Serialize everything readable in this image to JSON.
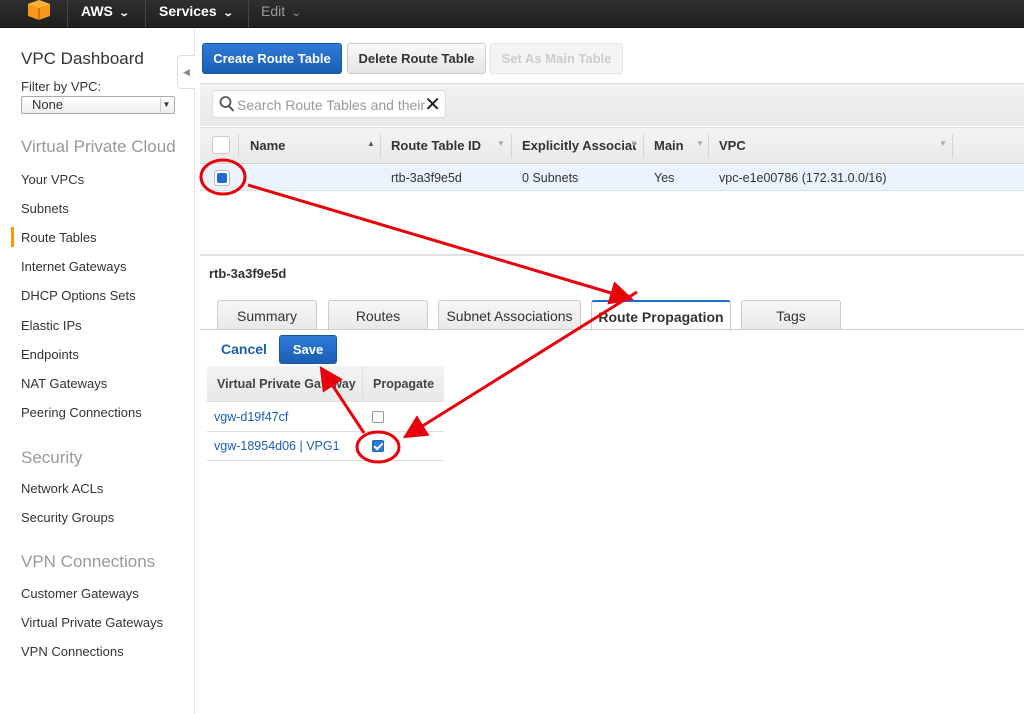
{
  "topbar": {
    "logo_icon": "aws-cube-icon",
    "menus": [
      {
        "label": "AWS",
        "dim": false
      },
      {
        "label": "Services",
        "dim": false
      },
      {
        "label": "Edit",
        "dim": true
      }
    ]
  },
  "sidebar": {
    "title": "VPC Dashboard",
    "filter_label": "Filter by VPC:",
    "filter_value": "None",
    "sections": [
      {
        "title": "Virtual Private Cloud",
        "items": [
          "Your VPCs",
          "Subnets",
          "Route Tables",
          "Internet Gateways",
          "DHCP Options Sets",
          "Elastic IPs",
          "Endpoints",
          "NAT Gateways",
          "Peering Connections"
        ]
      },
      {
        "title": "Security",
        "items": [
          "Network ACLs",
          "Security Groups"
        ]
      },
      {
        "title": "VPN Connections",
        "items": [
          "Customer Gateways",
          "Virtual Private Gateways",
          "VPN Connections"
        ]
      }
    ],
    "active_item": "Route Tables",
    "accent_color": "#ff9900"
  },
  "toolbar": {
    "create_label": "Create Route Table",
    "delete_label": "Delete Route Table",
    "set_main_label": "Set As Main Table"
  },
  "search": {
    "placeholder": "Search Route Tables and their",
    "value": ""
  },
  "table": {
    "columns": [
      "Name",
      "Route Table ID",
      "Explicitly Associat",
      "Main",
      "VPC"
    ],
    "rows": [
      {
        "selected": true,
        "name": "",
        "route_table_id": "rtb-3a3f9e5d",
        "explicitly_associated": "0 Subnets",
        "main": "Yes",
        "vpc": "vpc-e1e00786 (172.31.0.0/16)"
      }
    ]
  },
  "detail": {
    "title": "rtb-3a3f9e5d",
    "tabs": [
      "Summary",
      "Routes",
      "Subnet Associations",
      "Route Propagation",
      "Tags"
    ],
    "active_tab": "Route Propagation",
    "cancel_label": "Cancel",
    "save_label": "Save",
    "propagation": {
      "columns": [
        "Virtual Private Gateway",
        "Propagate"
      ],
      "rows": [
        {
          "gateway": "vgw-d19f47cf",
          "propagate": false
        },
        {
          "gateway": "vgw-18954d06 | VPG1",
          "propagate": true
        }
      ]
    }
  },
  "colors": {
    "primary_blue": "#1a5fb4",
    "annotation_red": "#e8000b",
    "selected_row": "#eaf3fd"
  }
}
